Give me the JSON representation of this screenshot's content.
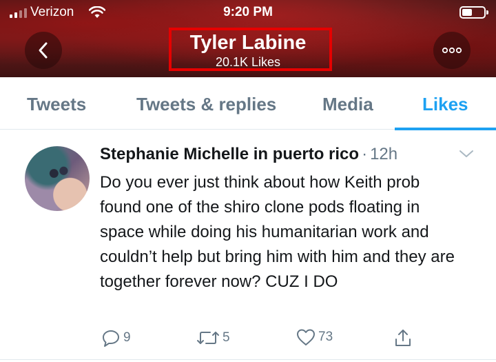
{
  "status_bar": {
    "carrier": "Verizon",
    "time": "9:20 PM"
  },
  "header": {
    "name": "Tyler Labine",
    "subtitle": "20.1K Likes",
    "highlight_color": "#e60000"
  },
  "tabs": [
    {
      "label": "Tweets",
      "active": false
    },
    {
      "label": "Tweets & replies",
      "active": false
    },
    {
      "label": "Media",
      "active": false
    },
    {
      "label": "Likes",
      "active": true
    }
  ],
  "tweet": {
    "author": "Stephanie Michelle in puerto rico",
    "separator": "·",
    "time": "12h",
    "text": "Do you ever just think about how Keith prob found one of the shiro clone pods floating in space while doing his humanitarian work and couldn’t help but bring him with him and they are together forever now? CUZ I DO",
    "replies": "9",
    "retweets": "5",
    "likes": "73"
  },
  "colors": {
    "accent": "#1da1f2",
    "muted": "#657786",
    "text": "#14171a"
  }
}
